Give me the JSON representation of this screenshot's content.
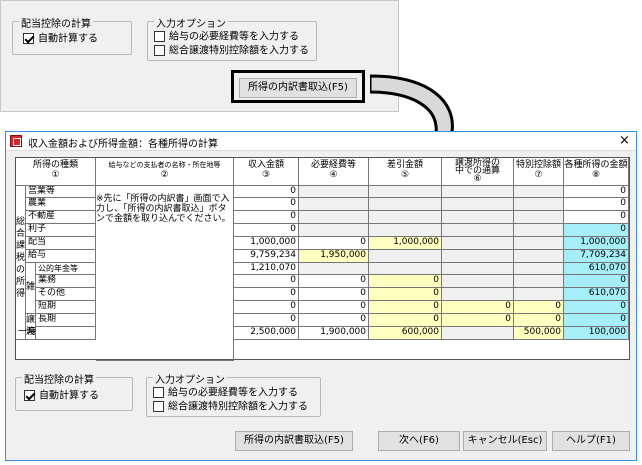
{
  "top_panel": {
    "group1_label": "配当控除の計算",
    "auto_calc_label": "自動計算する",
    "auto_calc_checked": true,
    "group2_label": "入力オプション",
    "option1_label": "給与の必要経費等を入力する",
    "option2_label": "総合譲渡特別控除額を入力する",
    "import_button": "所得の内訳書取込(F5)"
  },
  "window": {
    "title": "収入金額および所得金額：各種所得の計算",
    "close": "×",
    "headers": {
      "type": "所得の種類",
      "type_no": "①",
      "payer": "給与などの支払者の名称・所在地等",
      "payer_no": "②",
      "income": "収入金額",
      "income_no": "③",
      "expense": "必要経費等",
      "expense_no": "④",
      "diff": "差引金額",
      "diff_no": "⑤",
      "transfer_1": "譲渡所得の",
      "transfer_2": "中での通算",
      "transfer_no": "⑥",
      "special": "特別控除額",
      "special_no": "⑦",
      "amount": "各種所得の金額",
      "amount_no": "⑧"
    },
    "side_label": "総合課税の所得",
    "misc_label": "雑",
    "transfer_label": "譲渡",
    "note": "※先に「所得の内訳書」画面で入力し、「所得の内訳書取込」ボタンで金額を取り込んでください。",
    "rows": [
      {
        "name": "営業等",
        "income": "0",
        "expense": "",
        "diff": "",
        "transfer": "",
        "special": "",
        "amount": "0"
      },
      {
        "name": "農業",
        "income": "0",
        "expense": "",
        "diff": "",
        "transfer": "",
        "special": "",
        "amount": "0"
      },
      {
        "name": "不動産",
        "income": "0",
        "expense": "",
        "diff": "",
        "transfer": "",
        "special": "",
        "amount": "0"
      },
      {
        "name": "利子",
        "income": "0",
        "expense": "",
        "diff": "",
        "transfer": "",
        "special": "",
        "amount": "0"
      },
      {
        "name": "配当",
        "income": "1,000,000",
        "expense": "0",
        "diff": "1,000,000",
        "transfer": "",
        "special": "",
        "amount": "1,000,000"
      },
      {
        "name": "給与",
        "income": "9,759,234",
        "expense": "1,950,000",
        "diff": "",
        "transfer": "",
        "special": "",
        "amount": "7,709,234"
      },
      {
        "name": "公的年金等",
        "income": "1,210,070",
        "expense": "",
        "diff": "",
        "transfer": "",
        "special": "",
        "amount": "610,070"
      },
      {
        "name": "業務",
        "income": "0",
        "expense": "0",
        "diff": "0",
        "transfer": "",
        "special": "",
        "amount": "0"
      },
      {
        "name": "その他",
        "income": "0",
        "expense": "0",
        "diff": "0",
        "transfer": "",
        "special": "",
        "amount": "610,070"
      },
      {
        "name": "短期",
        "income": "0",
        "expense": "0",
        "diff": "0",
        "transfer": "0",
        "special": "0",
        "amount": "0"
      },
      {
        "name": "長期",
        "income": "0",
        "expense": "0",
        "diff": "0",
        "transfer": "0",
        "special": "0",
        "amount": "0"
      },
      {
        "name": "一時",
        "income": "2,500,000",
        "expense": "1,900,000",
        "diff": "600,000",
        "transfer": "",
        "special": "500,000",
        "amount": "100,000"
      }
    ],
    "bottom": {
      "group1_label": "配当控除の計算",
      "auto_calc_label": "自動計算する",
      "group2_label": "入力オプション",
      "option1_label": "給与の必要経費等を入力する",
      "option2_label": "総合譲渡特別控除額を入力する",
      "import_button": "所得の内訳書取込(F5)",
      "next_button": "次へ(F6)",
      "cancel_button": "キャンセル(Esc)",
      "help_button": "ヘルプ(F1)"
    }
  },
  "colors": {
    "yellow": "#ffffc0",
    "cyan": "#a6eef8",
    "title_accent": "#3a8ee6"
  }
}
